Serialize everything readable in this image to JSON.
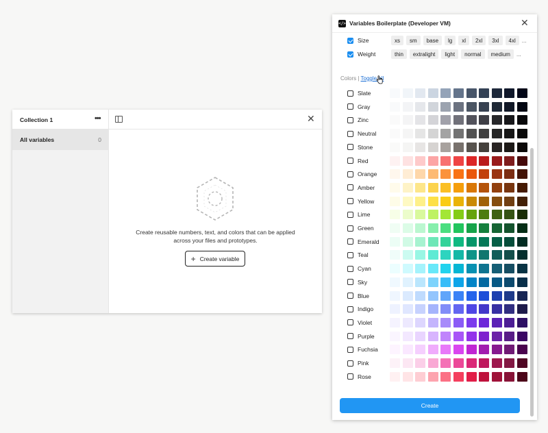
{
  "left_panel": {
    "collection_title": "Collection 1",
    "menu_glyph": "•••",
    "close_glyph": "✕",
    "sidebar": {
      "all_variables_label": "All variables",
      "all_variables_count": "0"
    },
    "empty_state": {
      "message": "Create reusable numbers, text, and colors that can be applied across your files and prototypes.",
      "button_label": "Create variable",
      "button_plus": "+"
    }
  },
  "plugin": {
    "title": "Variables Boilerplate (Developer VM)",
    "code_glyph": "</>",
    "close_glyph": "✕",
    "options": [
      {
        "label": "Size",
        "checked": true,
        "chips": [
          "xs",
          "sm",
          "base",
          "lg",
          "xl",
          "2xl",
          "3xl",
          "4xl"
        ],
        "more": "..."
      },
      {
        "label": "Weight",
        "checked": true,
        "chips": [
          "thin",
          "extralight",
          "light",
          "normal",
          "medium"
        ],
        "more": "..."
      }
    ],
    "colors_label": "Colors |",
    "toggle_all_label": "Toggle all",
    "colors": [
      {
        "name": "Slate",
        "checked": false,
        "swatches": [
          "#f8fafc",
          "#f1f5f9",
          "#e2e8f0",
          "#cbd5e1",
          "#94a3b8",
          "#64748b",
          "#475569",
          "#334155",
          "#1e293b",
          "#0f172a",
          "#020617"
        ]
      },
      {
        "name": "Gray",
        "checked": false,
        "swatches": [
          "#f9fafb",
          "#f3f4f6",
          "#e5e7eb",
          "#d1d5db",
          "#9ca3af",
          "#6b7280",
          "#4b5563",
          "#374151",
          "#1f2937",
          "#111827",
          "#030712"
        ]
      },
      {
        "name": "Zinc",
        "checked": false,
        "swatches": [
          "#fafafa",
          "#f4f4f5",
          "#e4e4e7",
          "#d4d4d8",
          "#a1a1aa",
          "#71717a",
          "#52525b",
          "#3f3f46",
          "#27272a",
          "#18181b",
          "#09090b"
        ]
      },
      {
        "name": "Neutral",
        "checked": false,
        "swatches": [
          "#fafafa",
          "#f5f5f5",
          "#e5e5e5",
          "#d4d4d4",
          "#a3a3a3",
          "#737373",
          "#525252",
          "#404040",
          "#262626",
          "#171717",
          "#0a0a0a"
        ]
      },
      {
        "name": "Stone",
        "checked": false,
        "swatches": [
          "#fafaf9",
          "#f5f5f4",
          "#e7e5e4",
          "#d6d3d1",
          "#a8a29e",
          "#78716c",
          "#57534e",
          "#44403c",
          "#292524",
          "#1c1917",
          "#0c0a09"
        ]
      },
      {
        "name": "Red",
        "checked": false,
        "swatches": [
          "#fef2f2",
          "#fee2e2",
          "#fecaca",
          "#fca5a5",
          "#f87171",
          "#ef4444",
          "#dc2626",
          "#b91c1c",
          "#991b1b",
          "#7f1d1d",
          "#450a0a"
        ]
      },
      {
        "name": "Orange",
        "checked": false,
        "swatches": [
          "#fff7ed",
          "#ffedd5",
          "#fed7aa",
          "#fdba74",
          "#fb923c",
          "#f97316",
          "#ea580c",
          "#c2410c",
          "#9a3412",
          "#7c2d12",
          "#431407"
        ]
      },
      {
        "name": "Amber",
        "checked": false,
        "swatches": [
          "#fffbeb",
          "#fef3c7",
          "#fde68a",
          "#fcd34d",
          "#fbbf24",
          "#f59e0b",
          "#d97706",
          "#b45309",
          "#92400e",
          "#78350f",
          "#451a03"
        ]
      },
      {
        "name": "Yellow",
        "checked": false,
        "swatches": [
          "#fefce8",
          "#fef9c3",
          "#fef08a",
          "#fde047",
          "#facc15",
          "#eab308",
          "#ca8a04",
          "#a16207",
          "#854d0e",
          "#713f12",
          "#422006"
        ]
      },
      {
        "name": "Lime",
        "checked": false,
        "swatches": [
          "#f7fee7",
          "#ecfccb",
          "#d9f99d",
          "#bef264",
          "#a3e635",
          "#84cc16",
          "#65a30d",
          "#4d7c0f",
          "#3f6212",
          "#365314",
          "#1a2e05"
        ]
      },
      {
        "name": "Green",
        "checked": false,
        "swatches": [
          "#f0fdf4",
          "#dcfce7",
          "#bbf7d0",
          "#86efac",
          "#4ade80",
          "#22c55e",
          "#16a34a",
          "#15803d",
          "#166534",
          "#14532d",
          "#052e16"
        ]
      },
      {
        "name": "Emerald",
        "checked": false,
        "swatches": [
          "#ecfdf5",
          "#d1fae5",
          "#a7f3d0",
          "#6ee7b7",
          "#34d399",
          "#10b981",
          "#059669",
          "#047857",
          "#065f46",
          "#064e3b",
          "#022c22"
        ]
      },
      {
        "name": "Teal",
        "checked": false,
        "swatches": [
          "#f0fdfa",
          "#ccfbf1",
          "#99f6e4",
          "#5eead4",
          "#2dd4bf",
          "#14b8a6",
          "#0d9488",
          "#0f766e",
          "#115e59",
          "#134e4a",
          "#042f2e"
        ]
      },
      {
        "name": "Cyan",
        "checked": false,
        "swatches": [
          "#ecfeff",
          "#cffafe",
          "#a5f3fc",
          "#67e8f9",
          "#22d3ee",
          "#06b6d4",
          "#0891b2",
          "#0e7490",
          "#155e75",
          "#164e63",
          "#083344"
        ]
      },
      {
        "name": "Sky",
        "checked": false,
        "swatches": [
          "#f0f9ff",
          "#e0f2fe",
          "#bae6fd",
          "#7dd3fc",
          "#38bdf8",
          "#0ea5e9",
          "#0284c7",
          "#0369a1",
          "#075985",
          "#0c4a6e",
          "#082f49"
        ]
      },
      {
        "name": "Blue",
        "checked": false,
        "swatches": [
          "#eff6ff",
          "#dbeafe",
          "#bfdbfe",
          "#93c5fd",
          "#60a5fa",
          "#3b82f6",
          "#2563eb",
          "#1d4ed8",
          "#1e40af",
          "#1e3a8a",
          "#172554"
        ]
      },
      {
        "name": "Indigo",
        "checked": false,
        "swatches": [
          "#eef2ff",
          "#e0e7ff",
          "#c7d2fe",
          "#a5b4fc",
          "#818cf8",
          "#6366f1",
          "#4f46e5",
          "#4338ca",
          "#3730a3",
          "#312e81",
          "#1e1b4b"
        ]
      },
      {
        "name": "Violet",
        "checked": false,
        "swatches": [
          "#f5f3ff",
          "#ede9fe",
          "#ddd6fe",
          "#c4b5fd",
          "#a78bfa",
          "#8b5cf6",
          "#7c3aed",
          "#6d28d9",
          "#5b21b6",
          "#4c1d95",
          "#2e1065"
        ]
      },
      {
        "name": "Purple",
        "checked": false,
        "swatches": [
          "#faf5ff",
          "#f3e8ff",
          "#e9d5ff",
          "#d8b4fe",
          "#c084fc",
          "#a855f7",
          "#9333ea",
          "#7e22ce",
          "#6b21a8",
          "#581c87",
          "#3b0764"
        ]
      },
      {
        "name": "Fuchsia",
        "checked": false,
        "swatches": [
          "#fdf4ff",
          "#fae8ff",
          "#f5d0fe",
          "#f0abfc",
          "#e879f9",
          "#d946ef",
          "#c026d3",
          "#a21caf",
          "#86198f",
          "#701a75",
          "#4a044e"
        ]
      },
      {
        "name": "Pink",
        "checked": false,
        "swatches": [
          "#fdf2f8",
          "#fce7f3",
          "#fbcfe8",
          "#f9a8d4",
          "#f472b6",
          "#ec4899",
          "#db2777",
          "#be185d",
          "#9d174d",
          "#831843",
          "#500724"
        ]
      },
      {
        "name": "Rose",
        "checked": false,
        "swatches": [
          "#fff1f2",
          "#ffe4e6",
          "#fecdd3",
          "#fda4af",
          "#fb7185",
          "#f43f5e",
          "#e11d48",
          "#be123c",
          "#9f1239",
          "#881337",
          "#4c0519"
        ]
      }
    ],
    "create_button_label": "Create",
    "accent_color": "#2196f3"
  }
}
